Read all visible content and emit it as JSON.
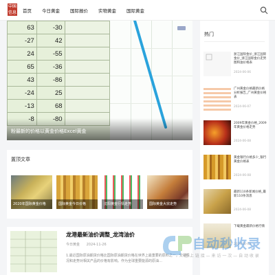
{
  "header": {
    "logo_lines": [
      "中国",
      "信息",
      "门户"
    ],
    "nav": [
      "首页",
      "今日黄金",
      "国际报价",
      "实物黄金",
      "国际黄金"
    ],
    "search_icon": "search-icon"
  },
  "featured": {
    "sheet_rows": [
      [
        "63",
        "-30"
      ],
      [
        "-27",
        "42"
      ],
      [
        "24",
        "-55"
      ],
      [
        "65",
        "-36"
      ],
      [
        "43",
        "-86"
      ],
      [
        "-24",
        "25"
      ],
      [
        "-13",
        "68"
      ],
      [
        "-8",
        "-80"
      ]
    ],
    "title": "粉最新的价格以黄金价格Excel黄金"
  },
  "recommended": {
    "title": "置顶文章",
    "items": [
      {
        "caption": "2020年国际黄金价格"
      },
      {
        "caption": "国际黄金今日价格"
      },
      {
        "caption": "沈阳黄金行情走势"
      },
      {
        "caption": "国际黄金大宗走势"
      }
    ]
  },
  "article": {
    "title": "龙港最新油价调整_龙湾油价",
    "category": "今日黄金",
    "date": "2024-11-26",
    "body": "1.最近国际原油期货价格比国际原油期货价格在世界上最重要的原料之一，交易情况和走势对相关产品的价格有影响。作为全球重要能源的原油…"
  },
  "sidebar": {
    "title": "热门",
    "items": [
      {
        "text": "浙江国际金价_浙江国际金价_浙江国际金价走势图和油价格表",
        "date": "2024-06-06"
      },
      {
        "text": "广州黄金价格最新价格分析报告_广州黄金价格表",
        "date": "2024-06-07"
      },
      {
        "text": "2009年黄金价格_2009年黄金价格走势",
        "date": "2024-06-08"
      },
      {
        "text": "黄金银行价格多少_银行黄金价格表",
        "date": "2024-06-08"
      },
      {
        "text": "最新110条新闻价格_最新110条消息",
        "date": "2024-06-08"
      },
      {
        "text": "下载黄金最新价格行情",
        "date": "2024-06-09"
      }
    ]
  },
  "watermark": {
    "brand": "自动秒收录",
    "slogan": "您 上 链 接 — 来 访 一 次 — 自 动 收 录"
  },
  "colors": {
    "accent": "#c0392b",
    "sheet_bg": "#e6f0da",
    "trend_line": "#2aa3dc"
  }
}
